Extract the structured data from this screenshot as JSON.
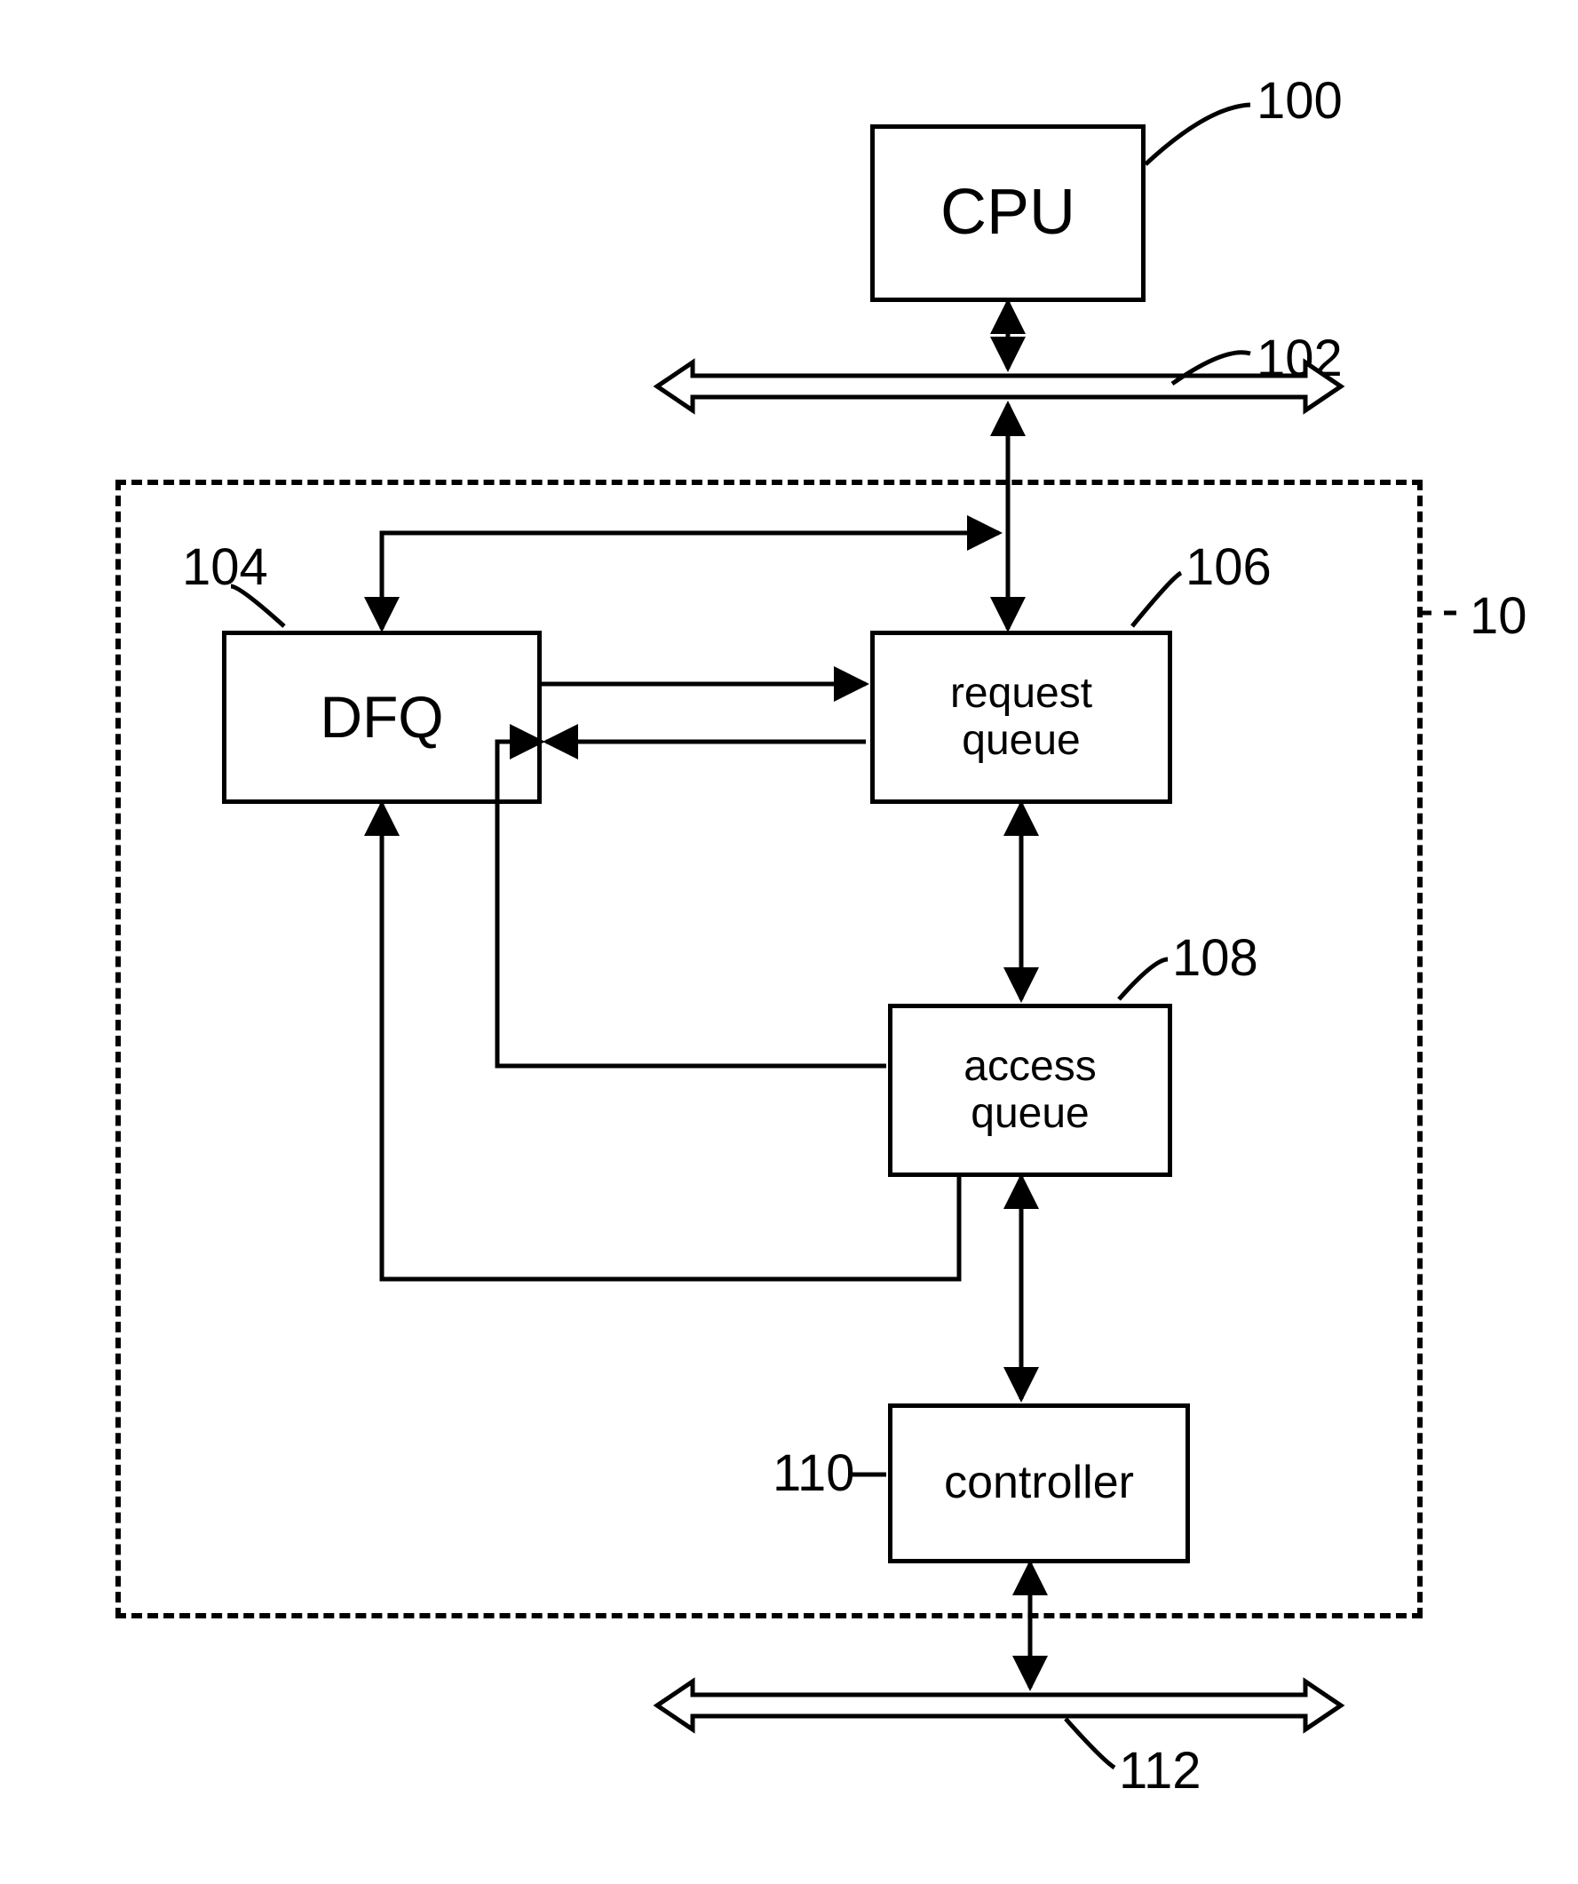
{
  "blocks": {
    "cpu": {
      "label": "CPU",
      "ref": "100"
    },
    "dfq": {
      "label": "DFQ",
      "ref": "104"
    },
    "request": {
      "label": "request\nqueue",
      "ref": "106"
    },
    "access": {
      "label": "access\nqueue",
      "ref": "108"
    },
    "controller": {
      "label": "controller",
      "ref": "110"
    }
  },
  "buses": {
    "top": {
      "ref": "102"
    },
    "bottom": {
      "ref": "112"
    }
  },
  "container": {
    "ref": "10"
  },
  "diagram_type": "block-diagram"
}
